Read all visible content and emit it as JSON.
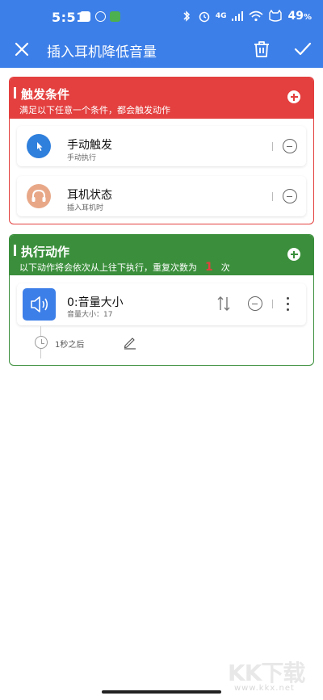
{
  "statusbar": {
    "time": "5:51",
    "network": "4G",
    "battery": "49",
    "battery_unit": "%"
  },
  "appbar": {
    "title": "插入耳机降低音量"
  },
  "triggers": {
    "title": "触发条件",
    "subtitle": "满足以下任意一个条件，都会触发动作",
    "items": [
      {
        "title": "手动触发",
        "subtitle": "手动执行",
        "icon": "touch-icon",
        "icon_color": "#2f7fdc"
      },
      {
        "title": "耳机状态",
        "subtitle": "插入耳机时",
        "icon": "headphones-icon",
        "icon_color": "#e8a888"
      }
    ]
  },
  "actions": {
    "title": "执行动作",
    "subtitle_prefix": "以下动作将会依次从上往下执行，重复次数为",
    "repeat_count": "1",
    "subtitle_suffix": "次",
    "items": [
      {
        "title": "0:音量大小",
        "subtitle": "音量大小：17",
        "icon": "speaker-icon",
        "delay": "1秒之后"
      }
    ]
  },
  "watermark": {
    "logo": "KK下载",
    "url": "www.kkx.net"
  },
  "colors": {
    "primary": "#3d7fe8",
    "trigger": "#e3403f",
    "action": "#3b8f3c"
  }
}
